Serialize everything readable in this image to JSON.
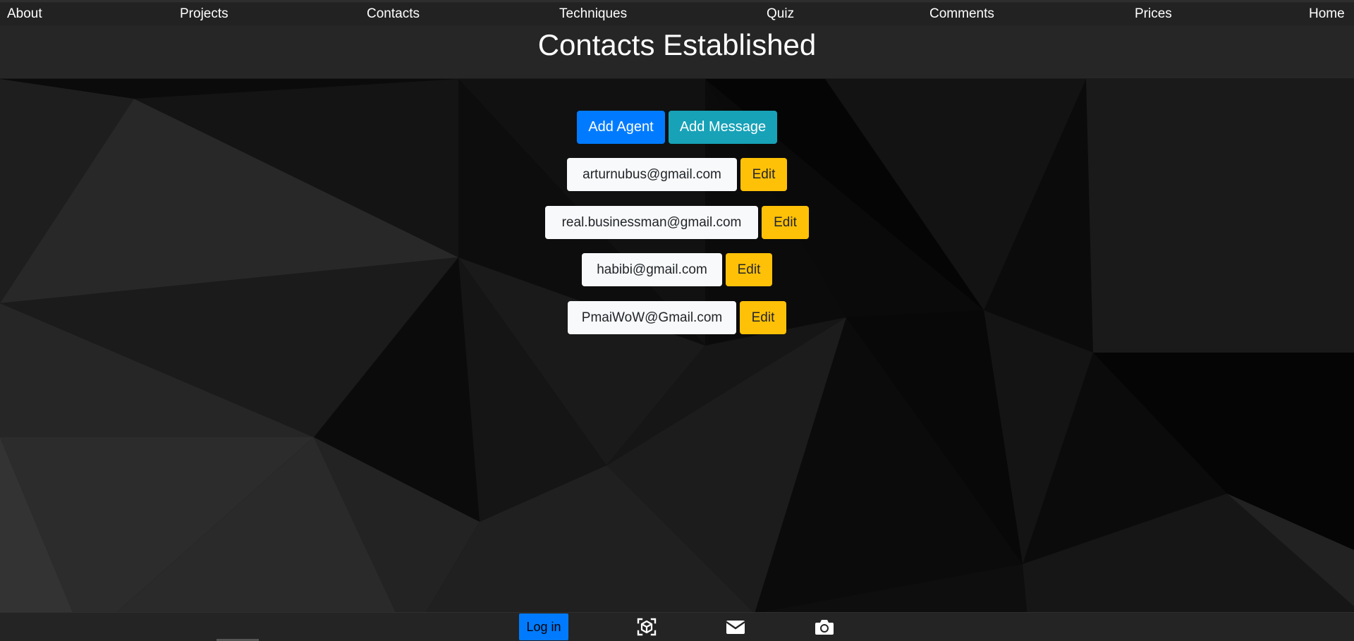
{
  "nav": {
    "items": [
      {
        "label": "About"
      },
      {
        "label": "Projects"
      },
      {
        "label": "Contacts"
      },
      {
        "label": "Techniques"
      },
      {
        "label": "Quiz"
      },
      {
        "label": "Comments"
      },
      {
        "label": "Prices"
      },
      {
        "label": "Home"
      }
    ]
  },
  "page": {
    "title": "Contacts Established"
  },
  "actions": {
    "add_agent": "Add Agent",
    "add_message": "Add Message"
  },
  "contacts": [
    {
      "email": "arturnubus@gmail.com",
      "edit_label": "Edit"
    },
    {
      "email": "real.businessman@gmail.com",
      "edit_label": "Edit"
    },
    {
      "email": "habibi@gmail.com",
      "edit_label": "Edit"
    },
    {
      "email": "PmaiWoW@Gmail.com",
      "edit_label": "Edit"
    }
  ],
  "footer": {
    "login_label": "Log in",
    "icons": [
      "ar-cube-icon",
      "mail-icon",
      "camera-icon"
    ]
  },
  "colors": {
    "primary": "#007bff",
    "info": "#17a2b8",
    "warning": "#ffc107",
    "light": "#f8f9fa",
    "header_bg": "#262626"
  }
}
